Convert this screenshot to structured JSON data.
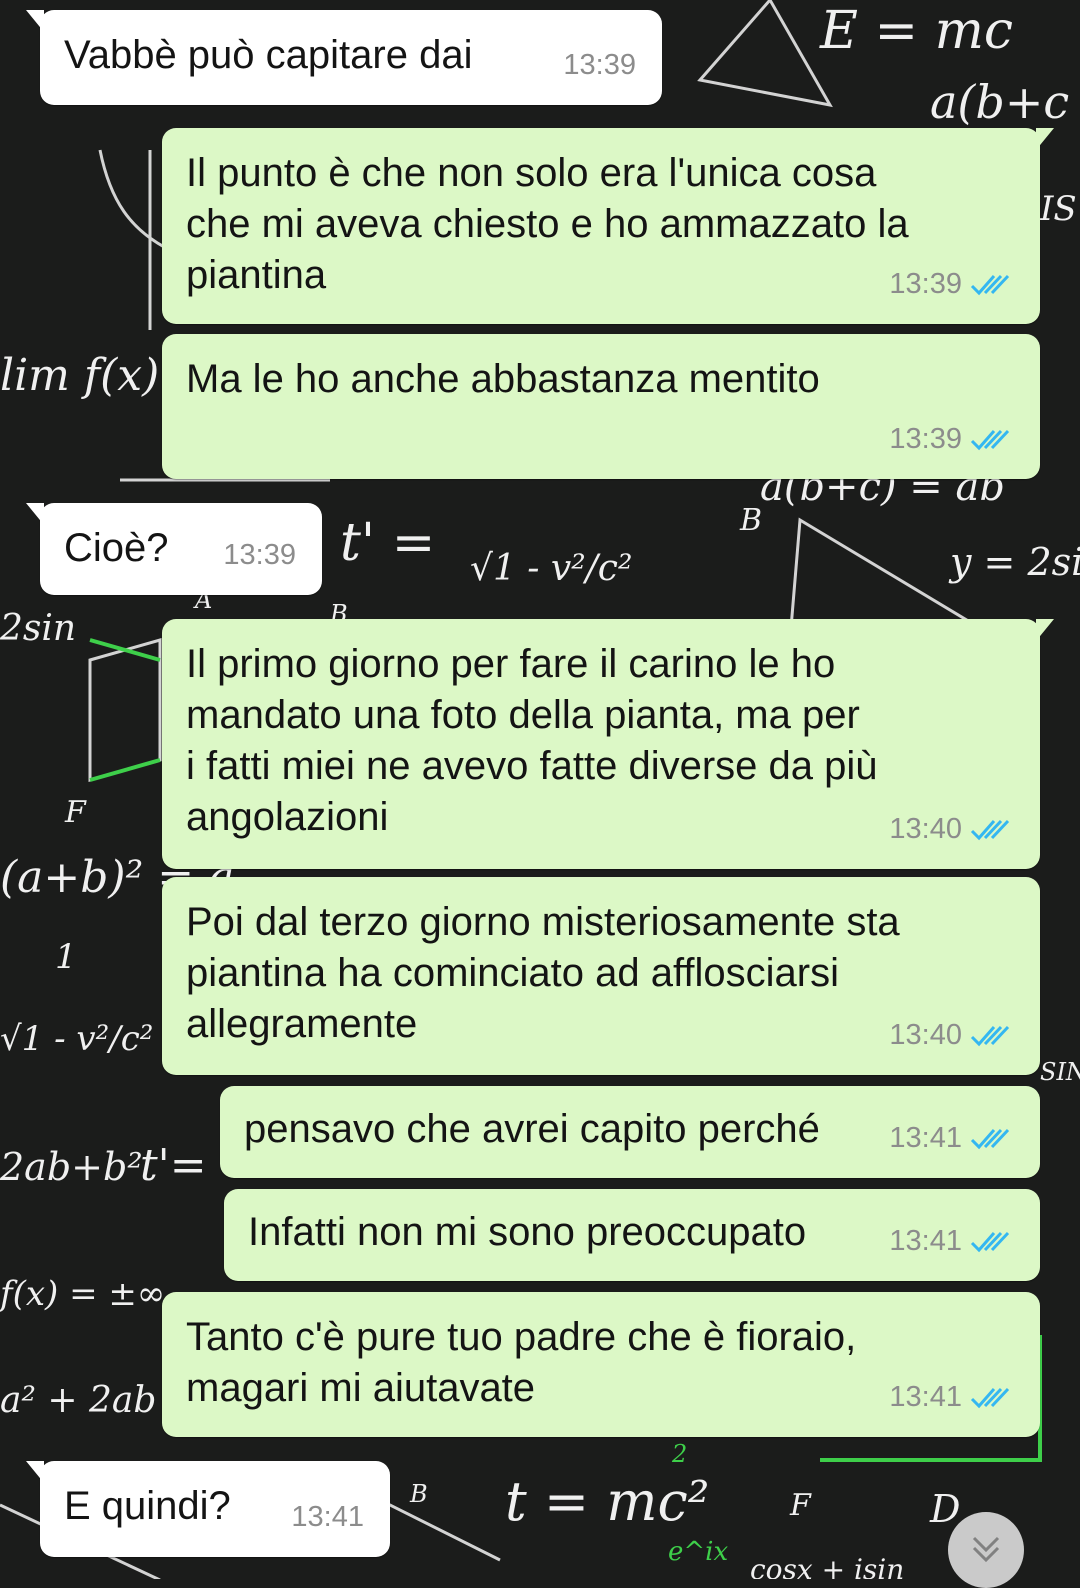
{
  "app": {
    "accent_tick_color": "#34b7f1",
    "outgoing_bubble": "#dcf8c6",
    "incoming_bubble": "#ffffff"
  },
  "wallpaper": {
    "formulas": [
      "E = mc",
      "a(b+c",
      "IS",
      "lim f(x) =",
      "a(b+c) = ab",
      "t' =",
      "√1 - v²/c²",
      "B",
      "y = 2si",
      "2sin",
      "A",
      "B",
      "F",
      "(a+b)² = a",
      "1",
      "√1 - v²/c²",
      "2ab+b²",
      "t'=",
      "SIN",
      "f(x) = ±∞",
      "a² + 2ab",
      "B",
      "t = mc²",
      "F",
      "D",
      "2",
      "e^ix",
      "cosx + isin"
    ]
  },
  "messages": [
    {
      "direction": "in",
      "text": [
        "Vabbè può capitare dai"
      ],
      "time": "13:39"
    },
    {
      "direction": "out",
      "text": [
        "Il punto è che non solo era l'unica cosa",
        "che mi aveva chiesto e ho ammazzato la",
        "piantina"
      ],
      "time": "13:39",
      "status": "read"
    },
    {
      "direction": "out",
      "text": [
        "Ma le ho anche abbastanza mentito"
      ],
      "time": "13:39",
      "status": "read"
    },
    {
      "direction": "in",
      "text": [
        "Cioè?"
      ],
      "time": "13:39"
    },
    {
      "direction": "out",
      "text": [
        "Il primo giorno per fare il carino le ho",
        "mandato una foto della pianta, ma per",
        "i fatti miei ne avevo fatte diverse da più",
        "angolazioni"
      ],
      "time": "13:40",
      "status": "read"
    },
    {
      "direction": "out",
      "text": [
        "Poi dal terzo giorno misteriosamente sta",
        "piantina ha cominciato ad afflosciarsi",
        "allegramente"
      ],
      "time": "13:40",
      "status": "read"
    },
    {
      "direction": "out",
      "text": [
        "pensavo che avrei capito perché"
      ],
      "time": "13:41",
      "status": "read"
    },
    {
      "direction": "out",
      "text": [
        "Infatti non mi sono preoccupato"
      ],
      "time": "13:41",
      "status": "read"
    },
    {
      "direction": "out",
      "text": [
        "Tanto c'è pure tuo padre che è fioraio,",
        "magari mi aiutavate"
      ],
      "time": "13:41",
      "status": "read"
    },
    {
      "direction": "in",
      "text": [
        "E quindi?"
      ],
      "time": "13:41"
    }
  ],
  "scroll_button": {
    "icon": "double-chevron-down-icon"
  }
}
